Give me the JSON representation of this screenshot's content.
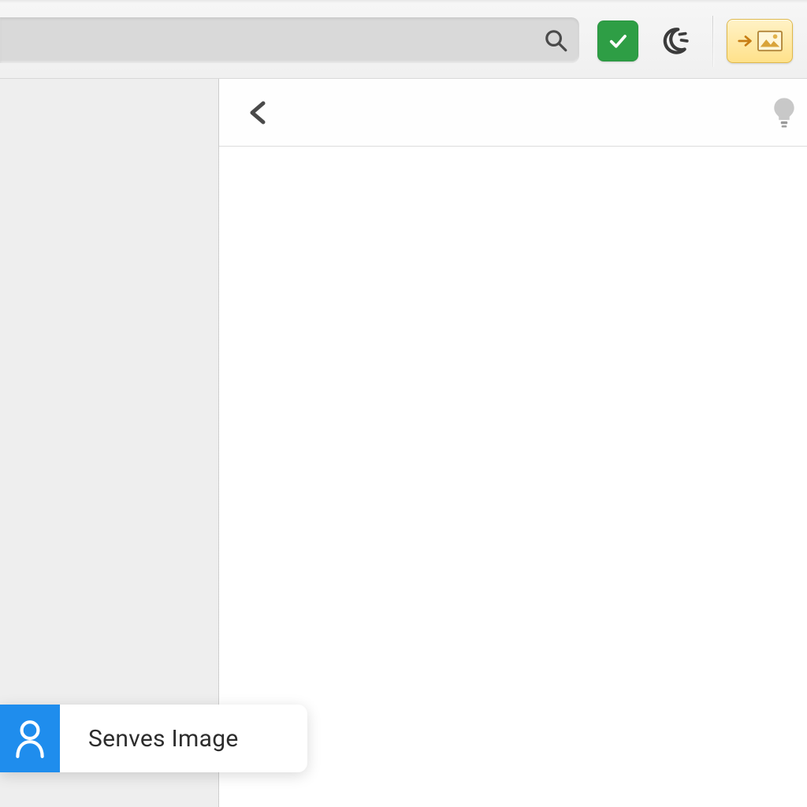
{
  "toolbar": {
    "search_placeholder": "",
    "search_value": ""
  },
  "popup": {
    "label": "Senves Image"
  },
  "icons": {
    "search": "search-icon",
    "check": "check-icon",
    "moon": "moon-icon",
    "arrow": "arrow-right-icon",
    "picture": "picture-icon",
    "back": "back-icon",
    "bulb": "lightbulb-icon",
    "person": "person-outline-icon"
  }
}
